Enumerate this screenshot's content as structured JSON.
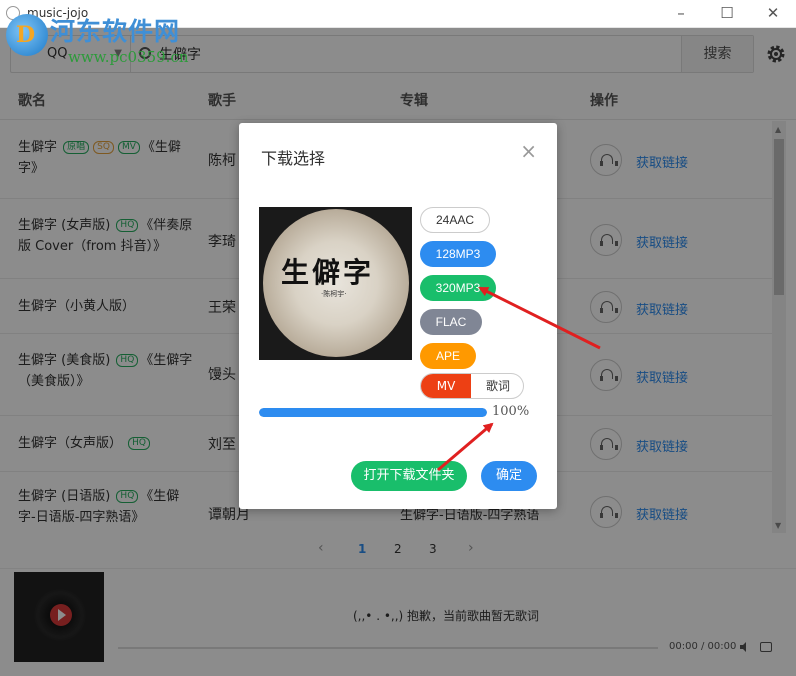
{
  "app": {
    "title": "music-jojo"
  },
  "window": {
    "minimize": "–",
    "maximize": "☐",
    "close": "✕"
  },
  "watermark": {
    "logo_letter": "D",
    "text": "河东软件网",
    "url": "www.pc0359.cn"
  },
  "search": {
    "source": "QQ",
    "query": "生僻字",
    "button": "搜索"
  },
  "table": {
    "headers": {
      "title": "歌名",
      "singer": "歌手",
      "album": "专辑",
      "action": "操作"
    },
    "rows": [
      {
        "title_pre": "生僻字",
        "tags": [
          "原唱",
          "SQ",
          "MV"
        ],
        "title_post": "《生僻字》",
        "singer": "陈柯",
        "album": "",
        "link": "获取链接"
      },
      {
        "title_pre": "生僻字 (女声版)",
        "tags": [
          "HQ"
        ],
        "title_post": "《伴奏原版 Cover（from 抖音）》",
        "singer": "李琦",
        "album": "",
        "link": "获取链接"
      },
      {
        "title_pre": "生僻字（小黄人版）",
        "tags": [],
        "title_post": "",
        "singer": "王荣",
        "album": "",
        "link": "获取链接"
      },
      {
        "title_pre": "生僻字 (美食版)",
        "tags": [
          "HQ"
        ],
        "title_post": "《生僻字（美食版）》",
        "singer": "馒头",
        "album": "",
        "link": "获取链接"
      },
      {
        "title_pre": "生僻字（女声版）",
        "tags": [
          "HQ"
        ],
        "title_post": "",
        "singer": "刘至",
        "album": "",
        "link": "获取链接"
      },
      {
        "title_pre": "生僻字 (日语版)",
        "tags": [
          "HQ"
        ],
        "title_post": "《生僻字-日语版-四字熟语》",
        "singer": "谭朝月",
        "album": "生僻字-日语版-四字熟语",
        "link": "获取链接"
      }
    ]
  },
  "pagination": {
    "prev": "‹",
    "next": "›",
    "pages": [
      "1",
      "2",
      "3"
    ],
    "active": "1"
  },
  "player": {
    "no_lyric": "(,,• . •,,) 抱歉，当前歌曲暂无歌词",
    "time": "00:00 / 00:00"
  },
  "modal": {
    "title": "下载选择",
    "close": "×",
    "cover_text": "生僻字",
    "cover_sub": "·陈柯宇·",
    "formats": {
      "aac": "24AAC",
      "mp3_128": "128MP3",
      "mp3_320": "320MP3",
      "flac": "FLAC",
      "ape": "APE"
    },
    "mv": "MV",
    "lyric": "歌词",
    "progress": 1.0,
    "progress_text": "100%",
    "open_folder": "打开下载文件夹",
    "confirm": "确定"
  },
  "colors": {
    "primary": "#2d8cf0",
    "success": "#19be6b",
    "warning": "#ff9900",
    "danger": "#ed4014",
    "gray": "#808695",
    "annotation": "#e02020"
  }
}
